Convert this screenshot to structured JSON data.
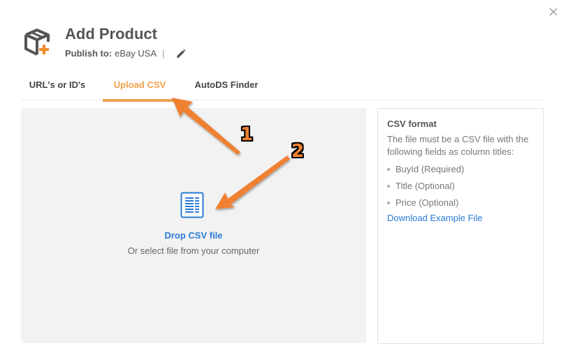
{
  "dialog": {
    "close_icon": "close-icon",
    "title": "Add Product",
    "icon": "package-add-icon",
    "publish_label": "Publish to:",
    "publish_value": "eBay USA",
    "separator": "|",
    "edit_icon": "pencil-icon"
  },
  "tabs": [
    {
      "label": "URL's or ID's",
      "active": false
    },
    {
      "label": "Upload CSV",
      "active": true
    },
    {
      "label": "AutoDS Finder",
      "active": false
    }
  ],
  "accent_color": "#f0a04b",
  "link_color": "#2a7ad6",
  "dropzone": {
    "icon": "csv-file-icon",
    "title": "Drop CSV file",
    "subtitle": "Or select file from your computer"
  },
  "csv_format": {
    "heading": "CSV format",
    "description": "The file must be a CSV file with the following fields as column titles:",
    "fields": [
      "BuyId (Required)",
      "Title (Optional)",
      "Price (Optional)"
    ],
    "download_link": "Download Example File"
  },
  "annotations": [
    {
      "number": "1",
      "points_to": "Upload CSV tab"
    },
    {
      "number": "2",
      "points_to": "Drop CSV file icon"
    }
  ]
}
